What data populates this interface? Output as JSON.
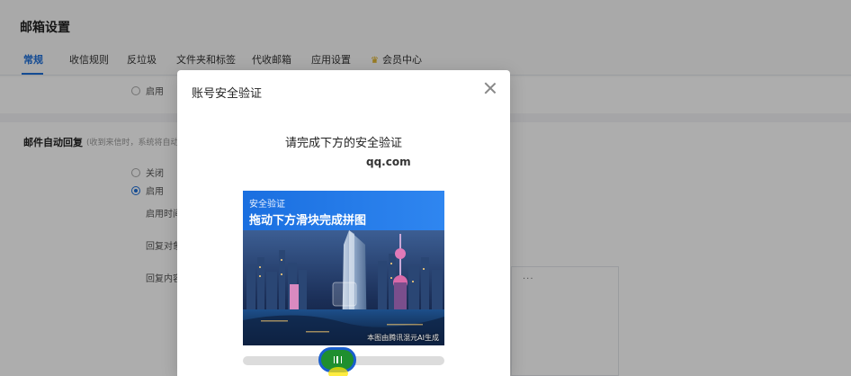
{
  "page": {
    "title": "邮箱设置",
    "tabs": [
      {
        "label": "常规",
        "active": true
      },
      {
        "label": "收信规则"
      },
      {
        "label": "反垃圾"
      },
      {
        "label": "文件夹和标签"
      },
      {
        "label": "代收邮箱"
      },
      {
        "label": "应用设置"
      },
      {
        "label": "会员中心"
      }
    ]
  },
  "settings": {
    "top_option_enable": "启用",
    "auto_reply": {
      "label": "邮件自动回复",
      "desc": "(收到来信时，系统将自动…",
      "option_off": "关闭",
      "option_on": "启用",
      "field_time": "启用时间",
      "field_target": "回复对象",
      "field_content": "回复内容",
      "editor_more": "···"
    }
  },
  "dialog": {
    "title": "账号安全验证",
    "verify_title": "请完成下方的安全验证",
    "domain": "qq.com",
    "captcha": {
      "small_text": "安全验证",
      "big_text": "拖动下方滑块完成拼图",
      "credit": "本图由腾讯混元AI生成"
    },
    "slider_position": 0.47
  },
  "colors": {
    "accent": "#1e6fd9",
    "slider_handle": "#1f8f2f",
    "banner": "#1a6fe0"
  }
}
